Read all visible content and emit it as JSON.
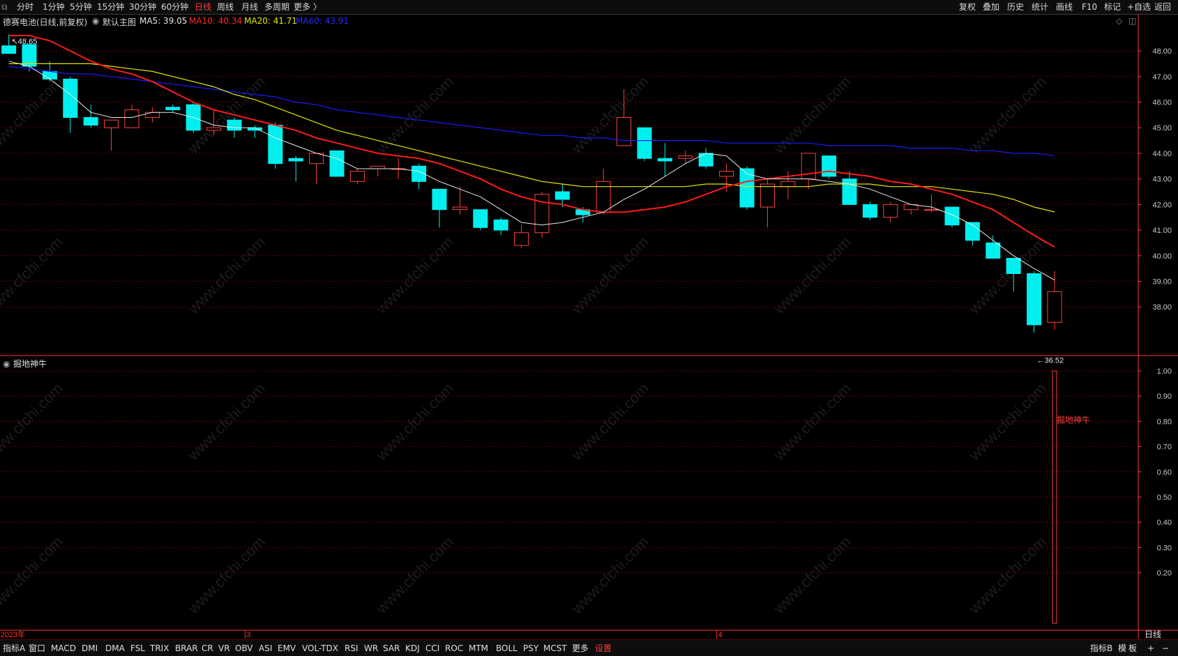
{
  "toolbar": {
    "left": [
      "分时",
      "1分钟",
      "5分钟",
      "15分钟",
      "30分钟",
      "60分钟",
      "日线",
      "周线",
      "月线",
      "多周期",
      "更多"
    ],
    "active": "日线",
    "right": [
      "复权",
      "叠加",
      "历史",
      "统计",
      "画线",
      "F10",
      "标记",
      "+自选",
      "返回"
    ]
  },
  "title": {
    "stock": "德赛电池(日线,前复权)",
    "main": "默认主图",
    "ma5": "MA5: 39.05",
    "ma10": "MA10: 40.34",
    "ma20": "MA20: 41.71",
    "ma60": "MA60: 43.91"
  },
  "indicator_title": "掘地神牛",
  "period_label": "日线",
  "bottom_tabs": [
    "指标A",
    "窗口",
    "MACD",
    "DMI",
    "DMA",
    "FSL",
    "TRIX",
    "BRAR",
    "CR",
    "VR",
    "OBV",
    "ASI",
    "EMV",
    "VOL-TDX",
    "RSI",
    "WR",
    "SAR",
    "KDJ",
    "CCI",
    "ROC",
    "MTM",
    "BOLL",
    "PSY",
    "MCST",
    "更多",
    "设置"
  ],
  "bottom_right": [
    "指标B",
    "模",
    "板",
    "+",
    "−"
  ],
  "watermark": "www.cfchi.com",
  "colors": {
    "up": "#ff4040",
    "down": "#00f0f0",
    "ma5": "#e8e8e8",
    "ma10": "#ff1a1a",
    "ma20": "#e6e600",
    "ma60": "#1a1aff",
    "grid": "#6a0000",
    "axis": "#ff3333",
    "text": "#c8c8c8"
  },
  "chart_data": [
    {
      "type": "candlestick",
      "y_ticks": [
        "48.00",
        "47.00",
        "46.00",
        "45.00",
        "44.00",
        "43.00",
        "42.00",
        "41.00",
        "40.00",
        "39.00",
        "38.00"
      ],
      "ylim": [
        36.1,
        48.9
      ],
      "x_labels": [
        {
          "label": "2023年",
          "index": 0
        },
        {
          "label": "3",
          "index": 12
        },
        {
          "label": "4",
          "index": 35
        }
      ],
      "high_label": "48.65",
      "low_label": "36.52",
      "candles": [
        [
          48.2,
          48.65,
          47.9,
          47.9
        ],
        [
          48.25,
          48.3,
          47.2,
          47.4
        ],
        [
          47.2,
          47.6,
          46.8,
          46.9
        ],
        [
          46.9,
          47.0,
          44.8,
          45.4
        ],
        [
          45.4,
          45.9,
          45.0,
          45.1
        ],
        [
          45.0,
          45.3,
          44.1,
          45.3
        ],
        [
          45.0,
          45.9,
          45.0,
          45.7
        ],
        [
          45.4,
          45.8,
          45.2,
          45.6
        ],
        [
          45.8,
          45.9,
          45.6,
          45.7
        ],
        [
          45.9,
          46.0,
          44.8,
          44.9
        ],
        [
          44.9,
          45.7,
          44.7,
          45.0
        ],
        [
          45.3,
          45.4,
          44.6,
          44.9
        ],
        [
          45.0,
          45.1,
          44.6,
          44.9
        ],
        [
          45.1,
          45.2,
          43.4,
          43.6
        ],
        [
          43.8,
          43.9,
          42.9,
          43.7
        ],
        [
          43.6,
          44.0,
          42.8,
          44.0
        ],
        [
          44.1,
          44.1,
          43.1,
          43.1
        ],
        [
          42.9,
          43.4,
          42.8,
          43.3
        ],
        [
          43.4,
          43.5,
          43.1,
          43.5
        ],
        [
          43.4,
          43.8,
          43.0,
          43.4
        ],
        [
          43.5,
          43.6,
          42.6,
          42.9
        ],
        [
          42.6,
          42.6,
          41.1,
          41.8
        ],
        [
          41.8,
          42.7,
          41.6,
          41.9
        ],
        [
          41.8,
          41.8,
          41.0,
          41.1
        ],
        [
          41.4,
          41.5,
          40.8,
          41.0
        ],
        [
          40.4,
          41.2,
          40.3,
          40.9
        ],
        [
          40.9,
          42.5,
          40.7,
          42.4
        ],
        [
          42.5,
          42.8,
          41.9,
          42.2
        ],
        [
          41.8,
          41.9,
          41.3,
          41.6
        ],
        [
          41.7,
          43.4,
          41.6,
          42.9
        ],
        [
          44.3,
          46.5,
          44.3,
          45.4
        ],
        [
          45.0,
          45.0,
          43.7,
          43.8
        ],
        [
          43.8,
          44.4,
          43.1,
          43.7
        ],
        [
          43.8,
          44.1,
          43.6,
          43.9
        ],
        [
          44.0,
          44.2,
          43.4,
          43.5
        ],
        [
          43.1,
          43.6,
          42.5,
          43.3
        ],
        [
          43.4,
          43.5,
          41.8,
          41.9
        ],
        [
          41.9,
          43.0,
          41.1,
          42.8
        ],
        [
          42.7,
          43.3,
          42.2,
          42.9
        ],
        [
          43.0,
          44.0,
          42.6,
          44.0
        ],
        [
          43.9,
          43.9,
          43.0,
          43.1
        ],
        [
          43.0,
          43.3,
          42.0,
          42.0
        ],
        [
          42.0,
          42.1,
          41.4,
          41.5
        ],
        [
          41.5,
          42.1,
          41.3,
          42.0
        ],
        [
          41.8,
          42.0,
          41.6,
          42.0
        ],
        [
          41.8,
          42.4,
          41.7,
          41.8
        ],
        [
          41.9,
          41.9,
          41.1,
          41.2
        ],
        [
          41.3,
          41.3,
          40.4,
          40.6
        ],
        [
          40.5,
          40.8,
          39.9,
          39.9
        ],
        [
          39.9,
          39.9,
          38.6,
          39.3
        ],
        [
          39.3,
          39.4,
          37.0,
          37.3
        ],
        [
          37.4,
          39.4,
          37.1,
          38.6
        ]
      ],
      "ma5": [
        47.6,
        47.4,
        46.9,
        46.3,
        45.6,
        45.4,
        45.4,
        45.6,
        45.6,
        45.4,
        45.1,
        45.0,
        45.0,
        44.6,
        44.3,
        44.0,
        43.8,
        43.4,
        43.4,
        43.4,
        43.3,
        42.9,
        42.6,
        42.3,
        41.8,
        41.3,
        41.2,
        41.3,
        41.5,
        41.7,
        42.2,
        42.6,
        43.1,
        43.6,
        44.0,
        43.9,
        43.2,
        43.0,
        43.0,
        43.0,
        42.9,
        42.8,
        42.6,
        42.3,
        42.0,
        41.9,
        41.6,
        41.2,
        40.6,
        40.0,
        39.5,
        39.05
      ],
      "ma10": [
        48.6,
        48.6,
        48.4,
        48.0,
        47.6,
        47.3,
        47.1,
        46.8,
        46.4,
        46.0,
        45.7,
        45.5,
        45.3,
        45.1,
        44.9,
        44.6,
        44.4,
        44.2,
        44.0,
        43.9,
        43.8,
        43.6,
        43.3,
        43.0,
        42.6,
        42.3,
        42.1,
        42.0,
        41.8,
        41.7,
        41.7,
        41.8,
        41.9,
        42.1,
        42.4,
        42.7,
        42.9,
        43.0,
        43.1,
        43.2,
        43.3,
        43.2,
        43.1,
        42.9,
        42.8,
        42.6,
        42.4,
        42.1,
        41.8,
        41.3,
        40.8,
        40.34
      ],
      "ma20": [
        47.5,
        47.5,
        47.5,
        47.5,
        47.5,
        47.4,
        47.3,
        47.2,
        47.0,
        46.8,
        46.6,
        46.3,
        46.1,
        45.8,
        45.5,
        45.2,
        44.9,
        44.7,
        44.5,
        44.3,
        44.1,
        43.9,
        43.7,
        43.5,
        43.3,
        43.1,
        42.9,
        42.8,
        42.7,
        42.7,
        42.7,
        42.7,
        42.7,
        42.7,
        42.8,
        42.8,
        42.7,
        42.7,
        42.7,
        42.7,
        42.8,
        42.8,
        42.8,
        42.7,
        42.7,
        42.7,
        42.6,
        42.5,
        42.4,
        42.2,
        41.9,
        41.71
      ],
      "ma60": [
        47.4,
        47.3,
        47.2,
        47.1,
        47.1,
        47.0,
        46.9,
        46.8,
        46.7,
        46.6,
        46.5,
        46.4,
        46.3,
        46.2,
        46.0,
        45.9,
        45.7,
        45.6,
        45.5,
        45.4,
        45.3,
        45.2,
        45.1,
        45.0,
        44.9,
        44.8,
        44.7,
        44.7,
        44.6,
        44.6,
        44.5,
        44.5,
        44.5,
        44.5,
        44.5,
        44.4,
        44.4,
        44.4,
        44.4,
        44.4,
        44.3,
        44.3,
        44.3,
        44.3,
        44.2,
        44.2,
        44.2,
        44.1,
        44.1,
        44.0,
        44.0,
        43.91
      ]
    },
    {
      "type": "bar",
      "title": "掘地神牛",
      "y_ticks": [
        "1.00",
        "0.90",
        "0.80",
        "0.70",
        "0.60",
        "0.50",
        "0.40",
        "0.30",
        "0.20"
      ],
      "ylim": [
        0,
        1.0
      ],
      "signal_index": 51,
      "signal_value": 1.0,
      "signal_label": "掘地神牛"
    }
  ]
}
